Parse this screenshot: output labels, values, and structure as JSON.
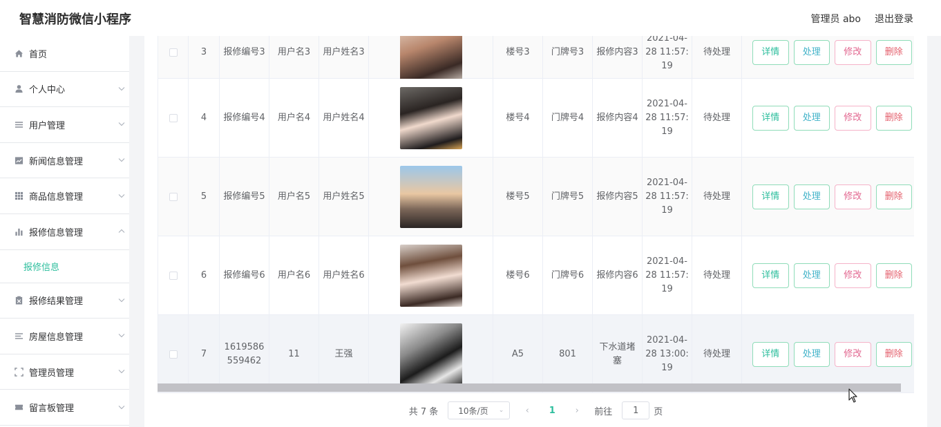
{
  "header": {
    "brand": "智慧消防微信小程序",
    "user_label": "管理员 abo",
    "logout": "退出登录"
  },
  "sidebar": {
    "items": [
      {
        "label": "首页",
        "icon": "home-icon",
        "chevron": ""
      },
      {
        "label": "个人中心",
        "icon": "user-icon",
        "chevron": "down"
      },
      {
        "label": "用户管理",
        "icon": "list-icon",
        "chevron": "down"
      },
      {
        "label": "新闻信息管理",
        "icon": "news-icon",
        "chevron": "down"
      },
      {
        "label": "商品信息管理",
        "icon": "grid-icon",
        "chevron": "down"
      },
      {
        "label": "报修信息管理",
        "icon": "bar-chart-icon",
        "chevron": "up"
      },
      {
        "label": "报修结果管理",
        "icon": "clipboard-icon",
        "chevron": "down"
      },
      {
        "label": "房屋信息管理",
        "icon": "menu-lines-icon",
        "chevron": "down"
      },
      {
        "label": "管理员管理",
        "icon": "frame-icon",
        "chevron": "down"
      },
      {
        "label": "留言板管理",
        "icon": "ticket-icon",
        "chevron": "down"
      }
    ],
    "active_sub": "报修信息"
  },
  "table": {
    "rows": [
      {
        "index": "3",
        "repair_no": "报修编号3",
        "username": "用户名3",
        "realname": "用户姓名3",
        "building": "楼号3",
        "door": "门牌号3",
        "content": "报修内容3",
        "time": "2021-04-28 11:57:19",
        "status": "待处理"
      },
      {
        "index": "4",
        "repair_no": "报修编号4",
        "username": "用户名4",
        "realname": "用户姓名4",
        "building": "楼号4",
        "door": "门牌号4",
        "content": "报修内容4",
        "time": "2021-04-28 11:57:19",
        "status": "待处理"
      },
      {
        "index": "5",
        "repair_no": "报修编号5",
        "username": "用户名5",
        "realname": "用户姓名5",
        "building": "楼号5",
        "door": "门牌号5",
        "content": "报修内容5",
        "time": "2021-04-28 11:57:19",
        "status": "待处理"
      },
      {
        "index": "6",
        "repair_no": "报修编号6",
        "username": "用户名6",
        "realname": "用户姓名6",
        "building": "楼号6",
        "door": "门牌号6",
        "content": "报修内容6",
        "time": "2021-04-28 11:57:19",
        "status": "待处理"
      },
      {
        "index": "7",
        "repair_no": "1619586559462",
        "username": "11",
        "realname": "王强",
        "building": "A5",
        "door": "801",
        "content": "下水道堵塞",
        "time": "2021-04-28 13:00:19",
        "status": "待处理"
      }
    ],
    "actions": {
      "detail": "详情",
      "handle": "处理",
      "edit": "修改",
      "delete": "删除"
    }
  },
  "pager": {
    "total": "共 7 条",
    "page_size": "10条/页",
    "current": "1",
    "goto_label": "前往",
    "goto_value": "1",
    "page_suffix": "页"
  },
  "colors": {
    "accent": "#2dbe9d",
    "edit": "#e2668f",
    "delete": "#e4606d"
  }
}
